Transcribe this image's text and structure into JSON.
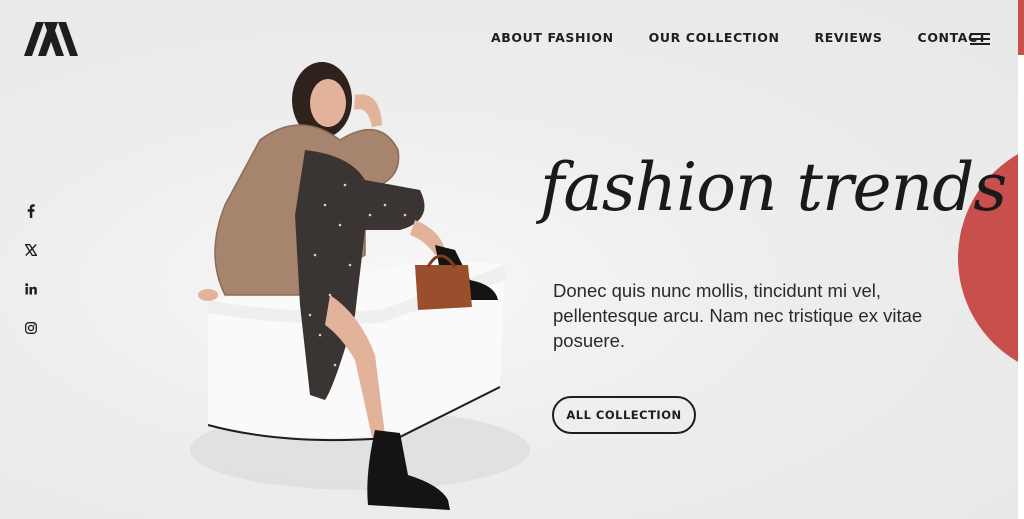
{
  "brand": {
    "logo_icon": "m-monogram-logo"
  },
  "nav": {
    "items": [
      {
        "label": "ABOUT FASHION"
      },
      {
        "label": "OUR COLLECTION"
      },
      {
        "label": "REVIEWS"
      },
      {
        "label": "CONTACT"
      }
    ],
    "menu_icon": "hamburger-menu-icon"
  },
  "social": {
    "items": [
      {
        "label": "f",
        "icon": "facebook-icon"
      },
      {
        "label": "𝕏",
        "icon": "x-twitter-icon"
      },
      {
        "label": "in",
        "icon": "linkedin-icon"
      },
      {
        "label": "",
        "icon": "instagram-icon"
      }
    ]
  },
  "hero": {
    "title": "fashion trends",
    "description": "Donec quis nunc mollis, tincidunt mi vel, pellentesque arcu. Nam nec tristique ex vitae posuere.",
    "cta_label": "ALL COLLECTION",
    "image": "model-seated-on-white-block"
  },
  "colors": {
    "accent": "#c94f4d",
    "text": "#1e1e1e",
    "background": "#ececec"
  }
}
